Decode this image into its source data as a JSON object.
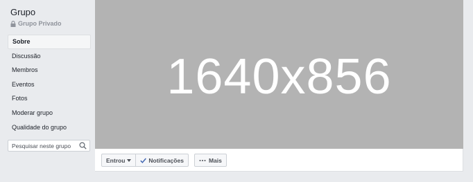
{
  "group": {
    "title": "Grupo",
    "privacy": "Grupo Privado"
  },
  "nav": {
    "items": [
      {
        "label": "Sobre"
      },
      {
        "label": "Discussão"
      },
      {
        "label": "Membros"
      },
      {
        "label": "Eventos"
      },
      {
        "label": "Fotos"
      },
      {
        "label": "Moderar grupo"
      },
      {
        "label": "Qualidade do grupo"
      }
    ],
    "active": "Sobre"
  },
  "search": {
    "placeholder": "Pesquisar neste grupo"
  },
  "cover": {
    "text": "1640x856",
    "color": "#b3b3b3"
  },
  "actions": {
    "joined": "Entrou",
    "notifications": "Notificações",
    "more": "Mais"
  },
  "colors": {
    "background": "#e9ebee",
    "check": "#4267b2"
  }
}
